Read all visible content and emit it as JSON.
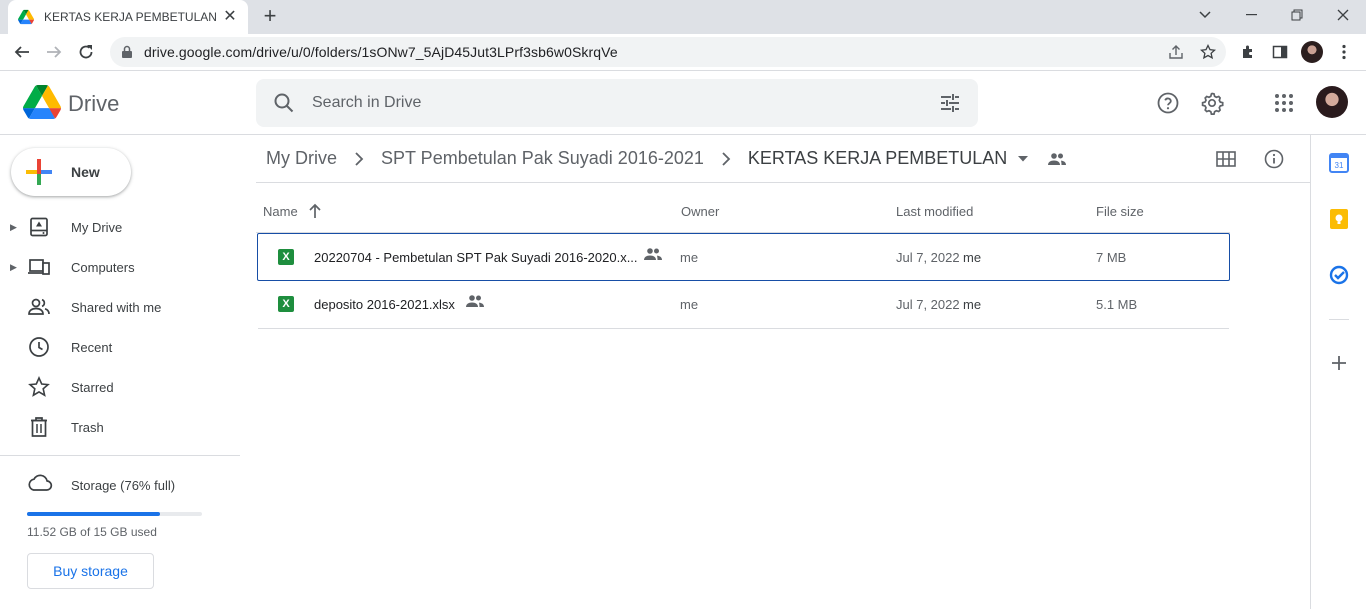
{
  "browser": {
    "tab_title": "KERTAS KERJA PEMBETULAN - Goo",
    "url": "drive.google.com/drive/u/0/folders/1sONw7_5AjD45Jut3LPrf3sb6w0SkrqVe"
  },
  "header": {
    "app_name": "Drive",
    "search_placeholder": "Search in Drive"
  },
  "sidebar": {
    "new_label": "New",
    "items": [
      {
        "label": "My Drive",
        "icon": "my-drive-icon"
      },
      {
        "label": "Computers",
        "icon": "computers-icon"
      },
      {
        "label": "Shared with me",
        "icon": "shared-icon"
      },
      {
        "label": "Recent",
        "icon": "clock-icon"
      },
      {
        "label": "Starred",
        "icon": "star-icon"
      },
      {
        "label": "Trash",
        "icon": "trash-icon"
      }
    ],
    "storage_label": "Storage (76% full)",
    "storage_fraction": 0.76,
    "storage_used": "11.52 GB of 15 GB used",
    "buy_label": "Buy storage"
  },
  "breadcrumb": {
    "items": [
      "My Drive",
      "SPT Pembetulan Pak Suyadi 2016-2021",
      "KERTAS KERJA PEMBETULAN"
    ]
  },
  "table": {
    "columns": [
      "Name",
      "Owner",
      "Last modified",
      "File size"
    ],
    "rows": [
      {
        "name": "20220704 - Pembetulan SPT Pak Suyadi 2016-2020.x...",
        "owner": "me",
        "modified": "Jul 7, 2022",
        "modified_by": "me",
        "size": "7 MB"
      },
      {
        "name": "deposito 2016-2021.xlsx",
        "owner": "me",
        "modified": "Jul 7, 2022",
        "modified_by": "me",
        "size": "5.1 MB"
      }
    ]
  },
  "file_badge": "X",
  "colors": {
    "accent": "#1a73e8",
    "excel": "#1e8e3e",
    "selected_border": "#174ea6"
  }
}
